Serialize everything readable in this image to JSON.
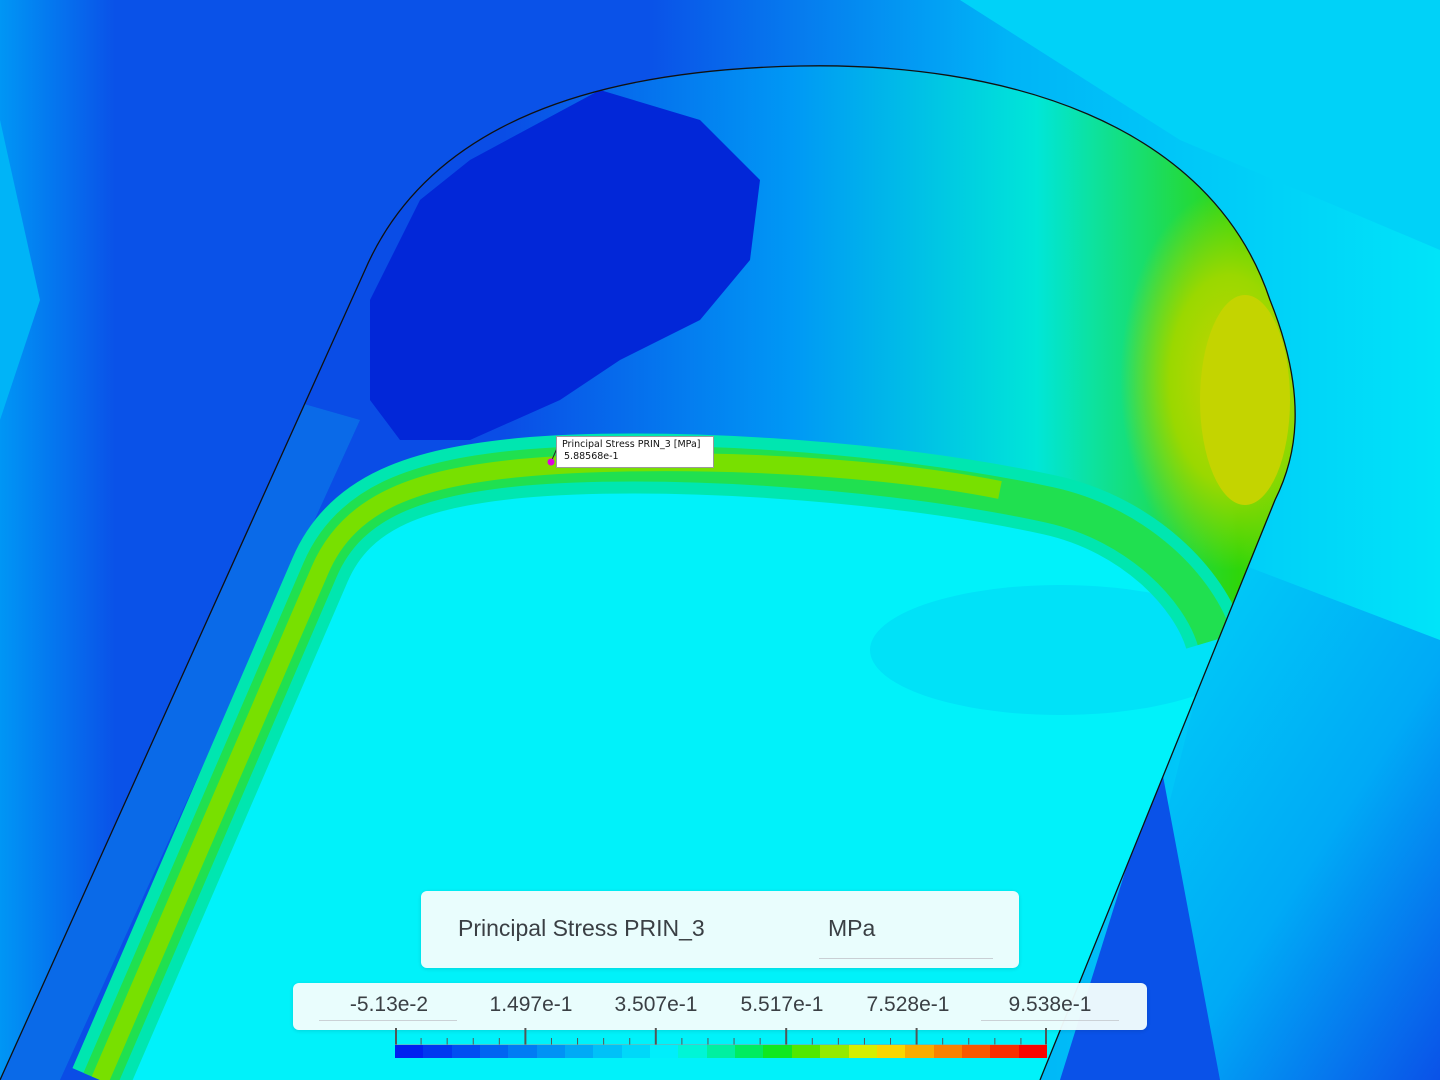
{
  "probe": {
    "title": "Principal Stress PRIN_3 [MPa]",
    "value": "5.88568e-1"
  },
  "legend": {
    "title": "Principal Stress PRIN_3",
    "unit": "MPa",
    "tick_labels": [
      "-5.13e-2",
      "1.497e-1",
      "3.507e-1",
      "5.517e-1",
      "7.528e-1",
      "9.538e-1"
    ],
    "min": -0.0513,
    "max": 0.9538,
    "colors": [
      "#0020f0",
      "#0037f0",
      "#004ef2",
      "#0065f2",
      "#007cf4",
      "#0093f5",
      "#00aaf6",
      "#00c1f8",
      "#00d8f9",
      "#00eefb",
      "#00f5d6",
      "#00f0a0",
      "#00ec60",
      "#10e820",
      "#52e800",
      "#94ea00",
      "#d6ee00",
      "#f8d600",
      "#f8ac00",
      "#f88200",
      "#f85800",
      "#f82e00",
      "#f80400"
    ]
  },
  "colors": {
    "deep_blue": "#0227d8",
    "mid_blue": "#0a52e8",
    "light_blue": "#0096f5",
    "cyan": "#00f0fa",
    "green": "#2ed60a",
    "yellow_green": "#bcd800",
    "probe_marker": "#e000e0"
  }
}
